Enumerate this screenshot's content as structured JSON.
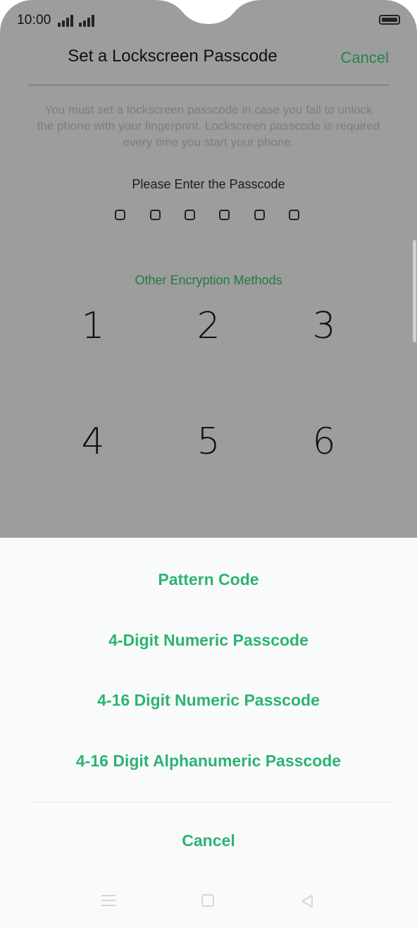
{
  "status_bar": {
    "time": "10:00",
    "icons": [
      "signal-icon",
      "signal-icon",
      "battery-icon"
    ]
  },
  "header": {
    "title": "Set a Lockscreen Passcode",
    "cancel_label": "Cancel"
  },
  "description": "You must set a lockscreen passcode in case you fail to unlock the phone with your fingerprint. Lockscreen passcode is required every time you start your phone.",
  "passcode": {
    "prompt": "Please Enter the Passcode",
    "digits": 6,
    "other_methods_label": "Other Encryption Methods"
  },
  "keypad": {
    "keys": [
      "1",
      "2",
      "3",
      "4",
      "5",
      "6"
    ]
  },
  "sheet": {
    "options": [
      "Pattern Code",
      "4-Digit Numeric Passcode",
      "4-16 Digit Numeric Passcode",
      "4-16 Digit Alphanumeric Passcode"
    ],
    "cancel_label": "Cancel"
  },
  "nav_bar": {
    "icons": [
      "menu-icon",
      "home-icon",
      "back-icon"
    ]
  },
  "colors": {
    "accent": "#2db372",
    "accent_dim": "#217a45",
    "dim_background": "#9d9d9d",
    "sheet_background": "#f9fbfb"
  }
}
